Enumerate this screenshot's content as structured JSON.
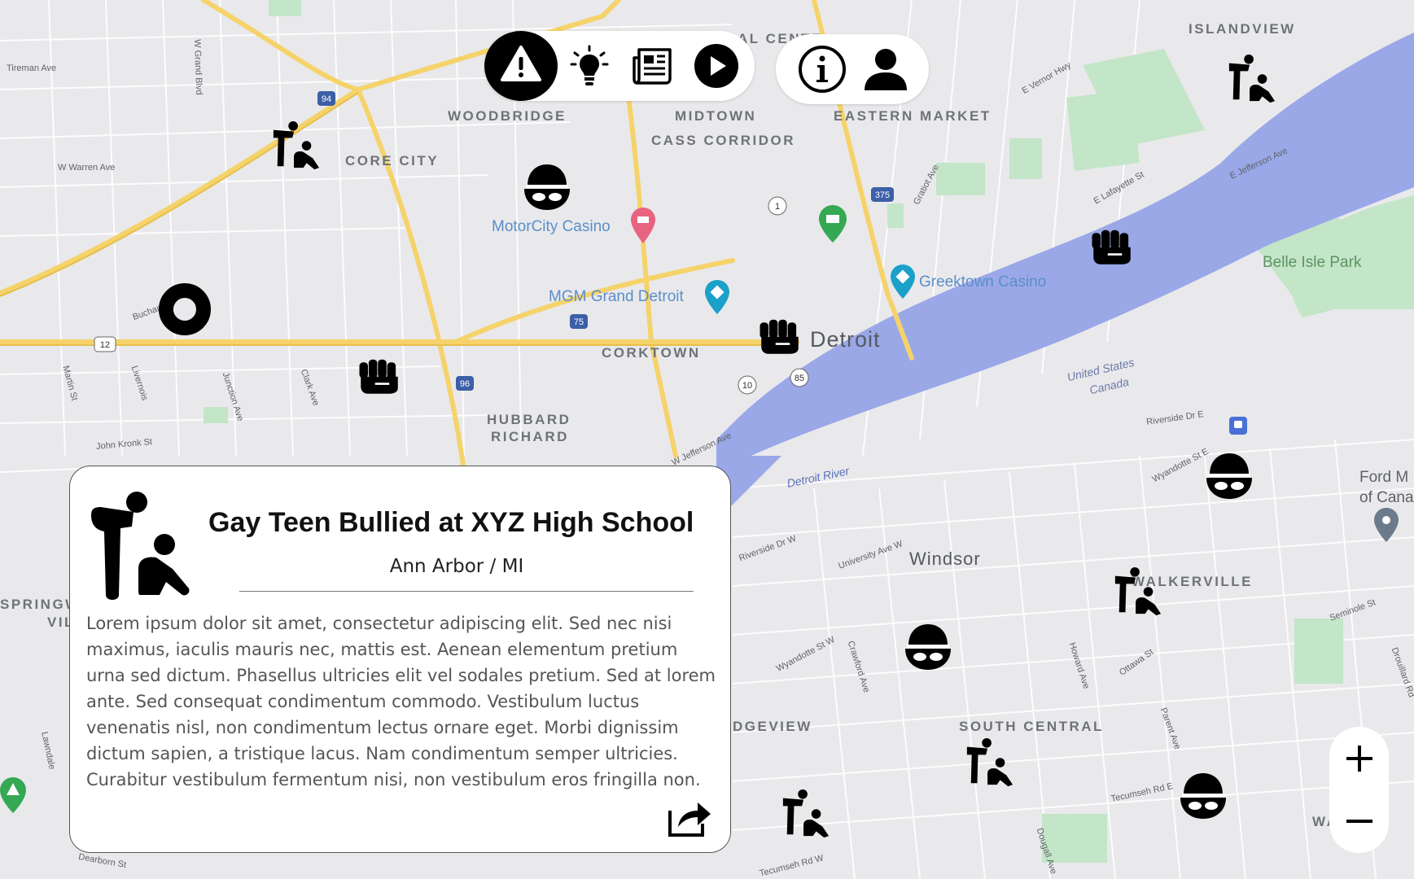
{
  "toolbar": {
    "buttons": [
      "alert",
      "ideas",
      "news",
      "play"
    ],
    "right_buttons": [
      "info",
      "profile"
    ]
  },
  "map": {
    "districts": [
      "WOODBRIDGE",
      "MIDTOWN",
      "CASS CORRIDOR",
      "EASTERN MARKET",
      "CORE CITY",
      "ISLANDVIEW",
      "CORKTOWN",
      "HUBBARD",
      "RICHARD",
      "SOUTH CENTRAL",
      "WALKERVILLE",
      "SPRINGW",
      "VILLA",
      "DGEVIEW",
      "WALK"
    ],
    "pois": {
      "motorcity": "MotorCity Casino",
      "mgm": "MGM Grand Detroit",
      "greektown": "Greektown Casino",
      "belle_isle": "Belle Isle Park",
      "ford_1": "Ford M",
      "ford_2": "of Cana",
      "al_center": "AL CENTE"
    },
    "cities": {
      "detroit": "Detroit",
      "windsor": "Windsor"
    },
    "water": {
      "detroit_river": "Detroit River",
      "us": "United States",
      "canada": "Canada"
    },
    "streets": [
      "Tireman Ave",
      "W Warren Ave",
      "W Grand Blvd",
      "John Kronk St",
      "Martin St",
      "Livernois",
      "Junction Ave",
      "Clark Ave",
      "Buchanan",
      "E Vernor Hwy",
      "Gratiot Ave",
      "E Lafayette St",
      "E Jefferson Ave",
      "W Jefferson Ave",
      "Riverside Dr E",
      "Wyandotte St E",
      "University Ave W",
      "Wyandotte St W",
      "Crawford Ave",
      "Howard Ave",
      "Ottawa St",
      "Parent Ave",
      "Tecumseh Rd E",
      "Seminole St",
      "Dougall Ave",
      "Riverside Dr W",
      "Lawndale",
      "Dearborn St",
      "Tecumseh Rd W",
      "Drouillard Rd"
    ],
    "shields": [
      "94",
      "75",
      "96",
      "375",
      "1",
      "10",
      "85",
      "12"
    ]
  },
  "markers": [
    {
      "type": "assault-icon"
    },
    {
      "type": "fist-icon"
    },
    {
      "type": "thief-icon"
    },
    {
      "type": "assault-icon"
    },
    {
      "type": "fist-icon"
    },
    {
      "type": "fist-icon"
    },
    {
      "type": "thief-icon"
    },
    {
      "type": "thief-icon"
    },
    {
      "type": "assault-icon"
    },
    {
      "type": "assault-icon"
    },
    {
      "type": "thief-icon"
    },
    {
      "type": "assault-icon"
    },
    {
      "type": "assault-icon"
    },
    {
      "type": "thief-icon"
    },
    {
      "type": "location-ring-icon"
    }
  ],
  "card": {
    "title": "Gay Teen Bullied at XYZ High School",
    "location": "Ann Arbor / MI",
    "body": "Lorem ipsum dolor sit amet, consectetur adipiscing elit. Sed nec nisi maximus, iaculis mauris nec, mattis est. Aenean elementum pretium urna sed dictum. Phasellus ultricies elit vel sodales pretium. Sed at lorem ante. Sed consequat condimentum commodo. Vestibulum luctus venenatis nisl, non condimentum lectus ornare eget. Morbi dignissim dictum sapien, a tristique lacus. Nam condimentum semper ultricies. Curabitur vestibulum fermentum nisi, non vestibulum eros fringilla non."
  },
  "zoom": {
    "plus": "+",
    "minus": "−"
  },
  "colors": {
    "map_bg": "#e9e9ec",
    "water": "#9aa8e8",
    "highway": "#f5d36a",
    "park": "#c3e5c8",
    "marker": "#000000"
  }
}
